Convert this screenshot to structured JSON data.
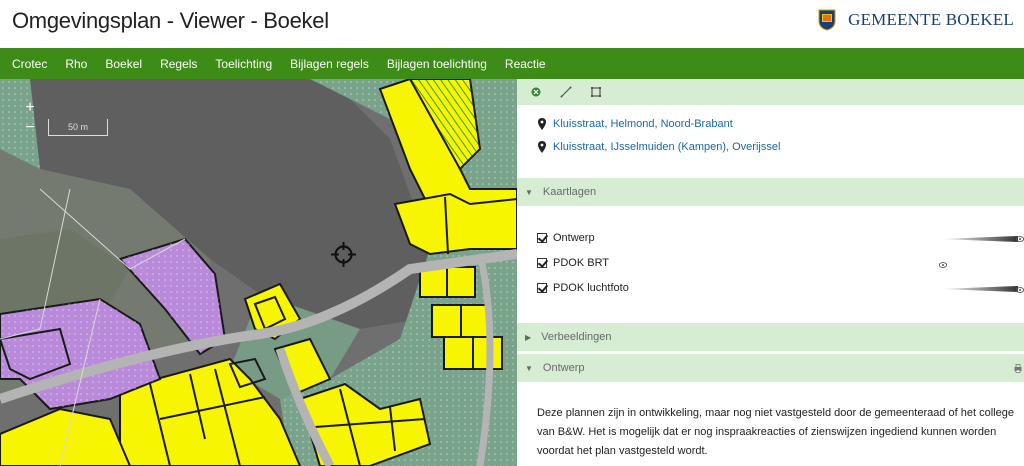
{
  "header": {
    "title": "Omgevingsplan - Viewer - Boekel",
    "brand_name": "GEMEENTE BOEKEL"
  },
  "nav": {
    "items": [
      "Crotec",
      "Rho",
      "Boekel",
      "Regels",
      "Toelichting",
      "Bijlagen regels",
      "Bijlagen toelichting",
      "Reactie"
    ]
  },
  "map": {
    "zoom_in": "+",
    "zoom_out": "−",
    "scale_label": "50 m",
    "colors": {
      "aerial": "#6b6b6b",
      "field": "#5e5e5e",
      "green_zone": "#7aa38b",
      "yellow_zone": "#f7f500",
      "purple_zone": "#b98ad9",
      "road": "#b4b4b4",
      "outline": "#1a1a1a"
    }
  },
  "panel": {
    "tools": [
      "close-circle-icon",
      "draw-line-icon",
      "draw-polygon-icon"
    ],
    "search_results": [
      "Kluisstraat, Helmond, Noord-Brabant",
      "Kluisstraat, IJsselmuiden (Kampen), Overijssel"
    ],
    "sections": {
      "kaartlagen": "Kaartlagen",
      "verbeeldingen": "Verbeeldingen",
      "ontwerp": "Ontwerp"
    },
    "layers": [
      {
        "label": "Ontwerp",
        "checked": true
      },
      {
        "label": "PDOK BRT",
        "checked": true
      },
      {
        "label": "PDOK luchtfoto",
        "checked": true
      }
    ],
    "description": "Deze plannen zijn in ontwikkeling, maar nog niet vastgesteld door de gemeenteraad of het college van B&W. Het is mogelijk dat er nog inspraakreacties of zienswijzen ingediend kunnen worden voordat het plan vastgesteld wordt."
  },
  "colors": {
    "nav_bg": "#3d8c18",
    "panel_section_bg": "#d6ecd3",
    "link": "#1a67a8",
    "brand": "#1a3d7a"
  }
}
